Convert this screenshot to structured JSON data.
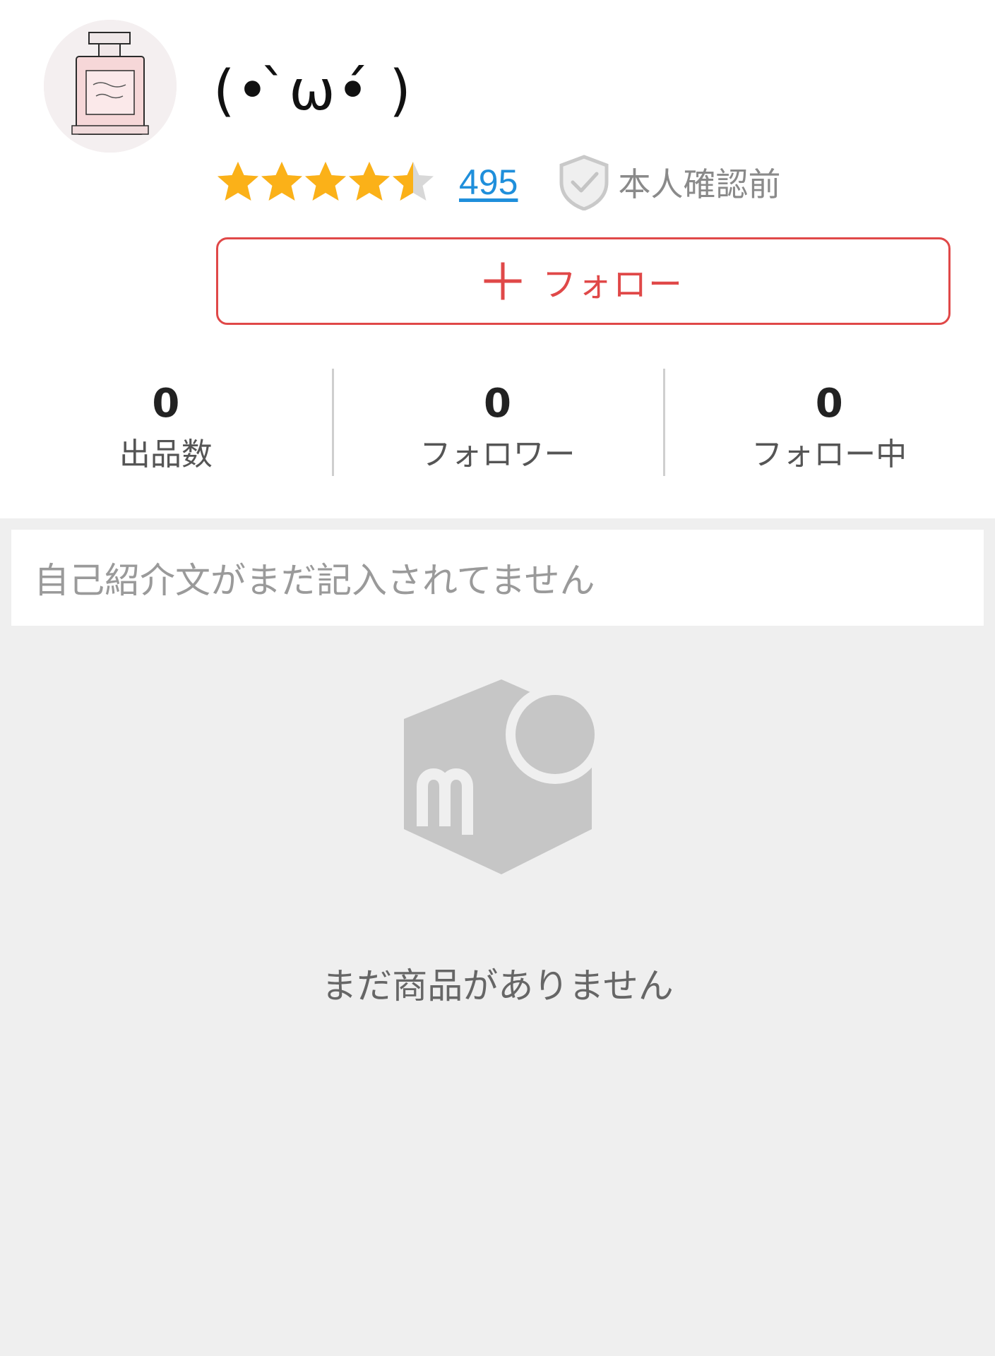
{
  "profile": {
    "username": "(• ̀ω•́ )",
    "rating": {
      "stars": 4.5,
      "max_stars": 5,
      "review_count": "495"
    },
    "verification_label": "本人確認前",
    "follow_button_label": "フォロー",
    "stats": [
      {
        "value": "0",
        "label": "出品数"
      },
      {
        "value": "0",
        "label": "フォロワー"
      },
      {
        "value": "0",
        "label": "フォロー中"
      }
    ]
  },
  "bio": {
    "text": "自己紹介文がまだ記入されてません"
  },
  "empty_state": {
    "message": "まだ商品がありません",
    "icon": "mercari-logo-icon"
  },
  "colors": {
    "accent": "#e04848",
    "link": "#1f8fdb",
    "star": "#fbb118",
    "star_empty": "#d8d8d8",
    "background": "#efefef"
  }
}
